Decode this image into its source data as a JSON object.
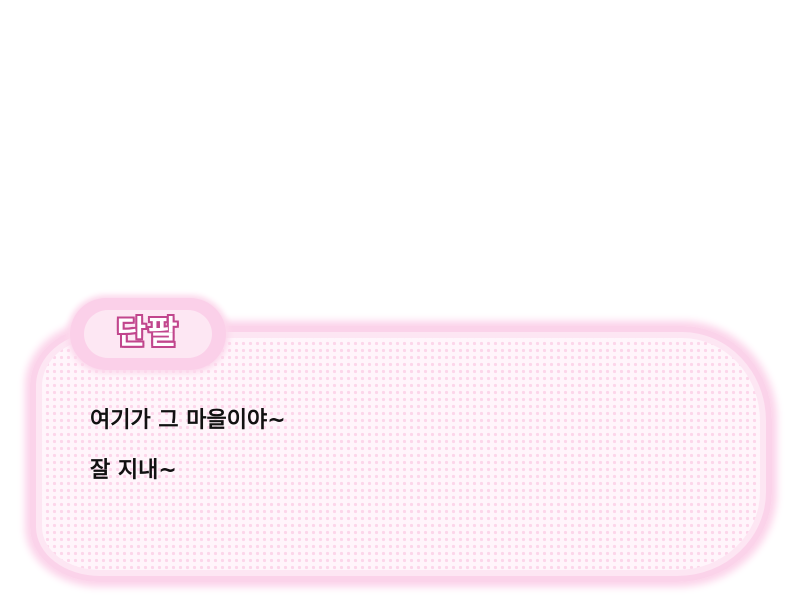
{
  "dialog": {
    "speaker": "단팔",
    "lines": [
      "여기가 그 마을이야~",
      "잘 지내~"
    ]
  },
  "colors": {
    "box_fill": "#fff5fb",
    "box_border": "#fbd3ea",
    "dot_pattern": "#fcd6ea",
    "nameplate": "#fbd0e9",
    "name_outline": "#c1468d",
    "text": "#111111"
  }
}
